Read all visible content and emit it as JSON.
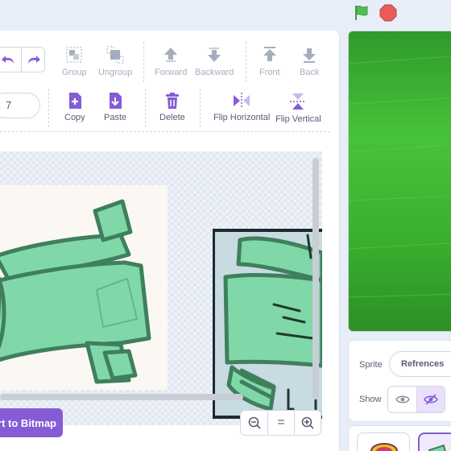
{
  "toolbar": {
    "costume_number_value": "7",
    "group_label": "Group",
    "ungroup_label": "Ungroup",
    "forward_label": "Forward",
    "backward_label": "Backward",
    "front_label": "Front",
    "back_label": "Back",
    "copy_label": "Copy",
    "paste_label": "Paste",
    "delete_label": "Delete",
    "flip_horizontal_label": "Flip Horizontal",
    "flip_vertical_label": "Flip Vertical"
  },
  "canvas": {
    "convert_button_label": "rt to Bitmap",
    "zoom_reset_label": "="
  },
  "sprite_info": {
    "sprite_label": "Sprite",
    "sprite_name": "Refrences",
    "show_label": "Show"
  },
  "colors": {
    "accent": "#855cd6",
    "tool_icon": "#855cd6",
    "disabled_icon": "#a6adbe",
    "flag": "#4cbf56",
    "stop": "#ec5959",
    "figure_fill": "#80d8a8",
    "figure_stroke": "#3f7f5e"
  },
  "icons": {
    "undo": "undo-icon",
    "redo": "redo-icon",
    "green_flag": "green-flag-icon",
    "stop": "stop-icon"
  }
}
